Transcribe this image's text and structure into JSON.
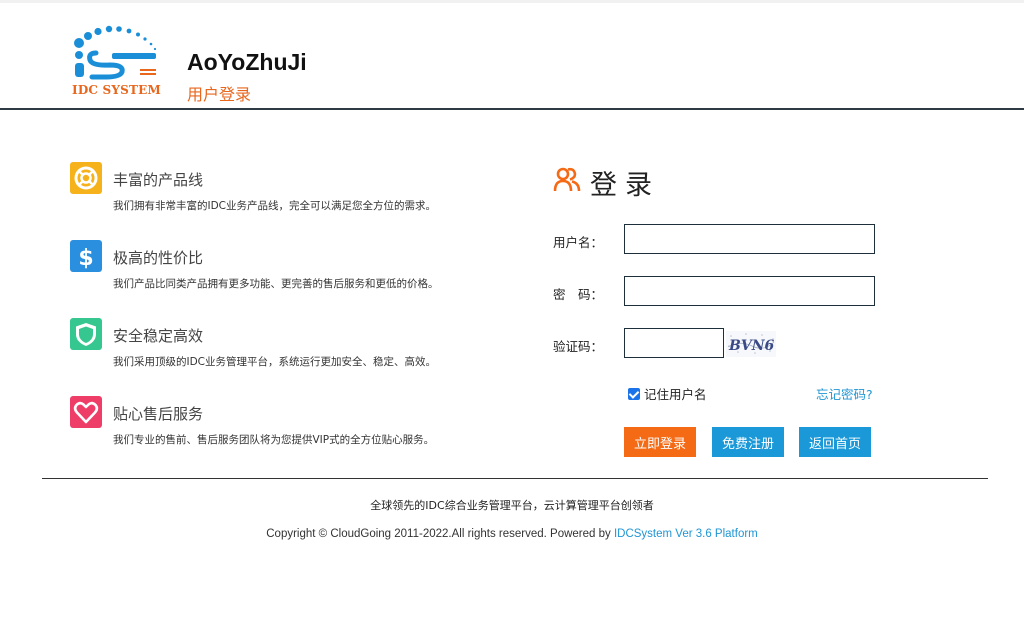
{
  "header": {
    "logo_text": "IDC SYSTEM",
    "title": "AoYoZhuJi",
    "subtitle": "用户登录"
  },
  "features": [
    {
      "icon": "lifebuoy-icon",
      "title": "丰富的产品线",
      "desc": "我们拥有非常丰富的IDC业务产品线，完全可以满足您全方位的需求。",
      "color": "#f5b21b"
    },
    {
      "icon": "dollar-icon",
      "title": "极高的性价比",
      "desc": "我们产品比同类产品拥有更多功能、更完善的售后服务和更低的价格。",
      "color": "#2b8fe0"
    },
    {
      "icon": "shield-icon",
      "title": "安全稳定高效",
      "desc": "我们采用顶级的IDC业务管理平台，系统运行更加安全、稳定、高效。",
      "color": "#35c78f"
    },
    {
      "icon": "heart-icon",
      "title": "贴心售后服务",
      "desc": "我们专业的售前、售后服务团队将为您提供VIP式的全方位贴心服务。",
      "color": "#ee3e67"
    }
  ],
  "login": {
    "heading": "登录",
    "username_label": "用户名：",
    "username_value": "",
    "password_label": "密　码：",
    "password_value": "",
    "captcha_label": "验证码：",
    "captcha_value": "",
    "captcha_text": "BVN6",
    "remember_label": "记住用户名",
    "remember_checked": true,
    "forgot_label": "忘记密码?",
    "login_button": "立即登录",
    "register_button": "免费注册",
    "home_button": "返回首页"
  },
  "footer": {
    "slogan": "全球领先的IDC综合业务管理平台，云计算管理平台创领者",
    "copyright": "Copyright © CloudGoing 2011-2022.All rights reserved. Powered by ",
    "powered_link": "IDCSystem Ver 3.6 Platform"
  },
  "colors": {
    "accent_orange": "#f46a15",
    "accent_blue": "#1a98d8",
    "logo_blue": "#1a8fd8"
  }
}
